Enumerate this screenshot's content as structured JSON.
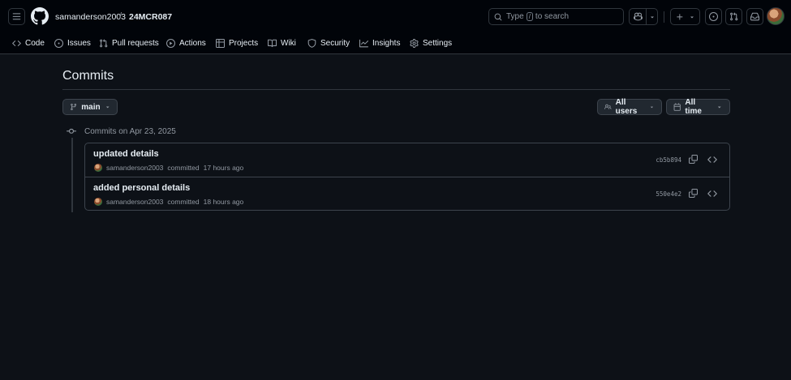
{
  "header": {
    "owner": "samanderson2003",
    "separator": "/",
    "repo": "24MCR087",
    "search_prefix": "Type",
    "search_key": "/",
    "search_suffix": "to search"
  },
  "nav": {
    "items": [
      {
        "label": "Code",
        "icon": "code-icon"
      },
      {
        "label": "Issues",
        "icon": "issue-icon"
      },
      {
        "label": "Pull requests",
        "icon": "pull-request-icon"
      },
      {
        "label": "Actions",
        "icon": "play-icon"
      },
      {
        "label": "Projects",
        "icon": "table-icon"
      },
      {
        "label": "Wiki",
        "icon": "book-icon"
      },
      {
        "label": "Security",
        "icon": "shield-icon"
      },
      {
        "label": "Insights",
        "icon": "graph-icon"
      },
      {
        "label": "Settings",
        "icon": "gear-icon"
      }
    ]
  },
  "page": {
    "title": "Commits",
    "branch": "main",
    "users_filter": "All users",
    "time_filter": "All time"
  },
  "groups": [
    {
      "label": "Commits on Apr 23, 2025",
      "commits": [
        {
          "title": "updated details",
          "author": "samanderson2003",
          "action": "committed",
          "when": "17 hours ago",
          "sha": "cb5b894"
        },
        {
          "title": "added personal details",
          "author": "samanderson2003",
          "action": "committed",
          "when": "18 hours ago",
          "sha": "550e4e2"
        }
      ]
    }
  ],
  "colors": {
    "background": "#0d1117",
    "header_background": "#010409",
    "border": "#30363d",
    "text": "#e6edf3",
    "muted": "#9198a1"
  }
}
